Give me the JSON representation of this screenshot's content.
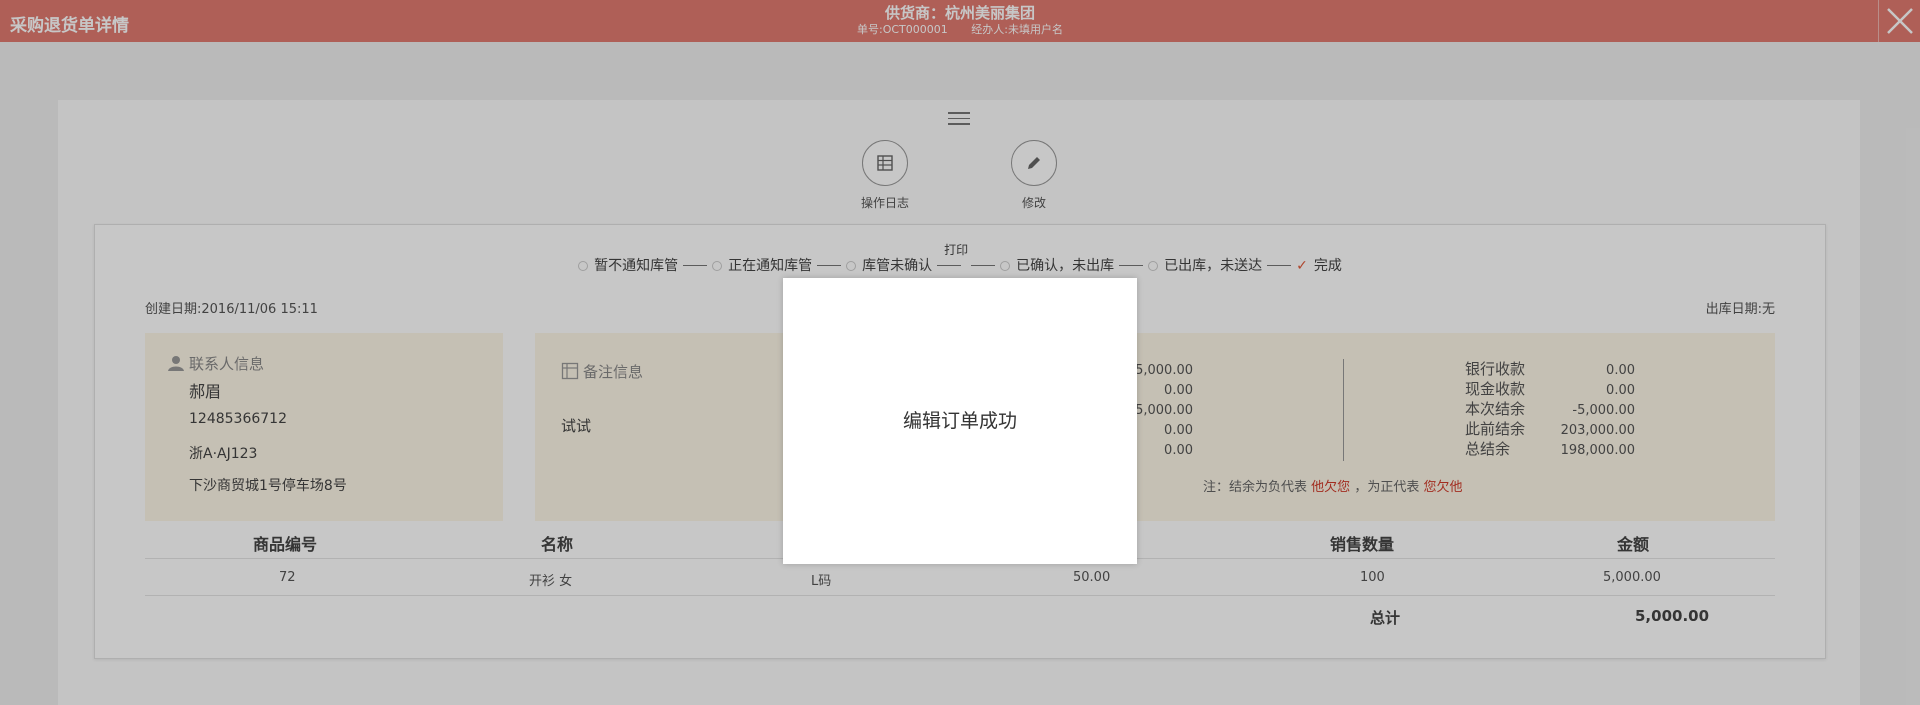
{
  "header": {
    "title": "采购退货单详情",
    "supplier": "供货商：杭州美丽集团",
    "order_no": "单号:OCT000001",
    "handler": "经办人:未填用户名",
    "background_color": "#e07a70",
    "close_icon": "close-icon"
  },
  "actions": [
    {
      "label": "操作日志",
      "icon": "table-icon"
    },
    {
      "label": "修改",
      "icon": "pencil-icon"
    }
  ],
  "steps": [
    {
      "label": "暂不通知库管",
      "state": "pending"
    },
    {
      "label": "正在通知库管",
      "state": "pending"
    },
    {
      "label": "库管未确认",
      "state": "pending"
    },
    {
      "label": "已确认，未出库",
      "state": "pending"
    },
    {
      "label": "已出库，未送达",
      "state": "pending"
    },
    {
      "label": "完成",
      "state": "done"
    }
  ],
  "print_label": "打印",
  "created_date": "创建日期:2016/11/06 15:11",
  "outbound_date": "出库日期:无",
  "contact": {
    "heading": "联系人信息",
    "name": "郝眉",
    "phone": "12485366712",
    "plate": "浙A·AJ123",
    "address": "下沙商贸城1号停车场8号"
  },
  "notes": {
    "heading": "备注信息",
    "content": "试试"
  },
  "amounts_mid": [
    "5,000.00",
    "0.00",
    "5,000.00",
    "0.00",
    "0.00"
  ],
  "amounts_right": {
    "labels": [
      "银行收款",
      "现金收款",
      "本次结余",
      "此前结余",
      "总结余"
    ],
    "values": [
      "0.00",
      "0.00",
      "-5,000.00",
      "203,000.00",
      "198,000.00"
    ]
  },
  "balance_note": {
    "prefix": "注：结余为负代表",
    "neg": "他欠您",
    "middle": "，为正代表",
    "pos": "您欠他"
  },
  "table": {
    "headers": {
      "code": "商品编号",
      "name": "名称",
      "qty": "销售数量",
      "amount": "金额"
    },
    "rows": [
      {
        "code": "72",
        "name": "开衫 女",
        "size": "L码",
        "price": "50.00",
        "qty": "100",
        "amount": "5,000.00"
      }
    ],
    "total_label": "总计",
    "total_value": "5,000.00"
  },
  "modal": {
    "message": "编辑订单成功"
  },
  "colors": {
    "accent": "#e07a70",
    "warning_red": "#d03a2a",
    "info_bg": "#fdf6e7"
  }
}
